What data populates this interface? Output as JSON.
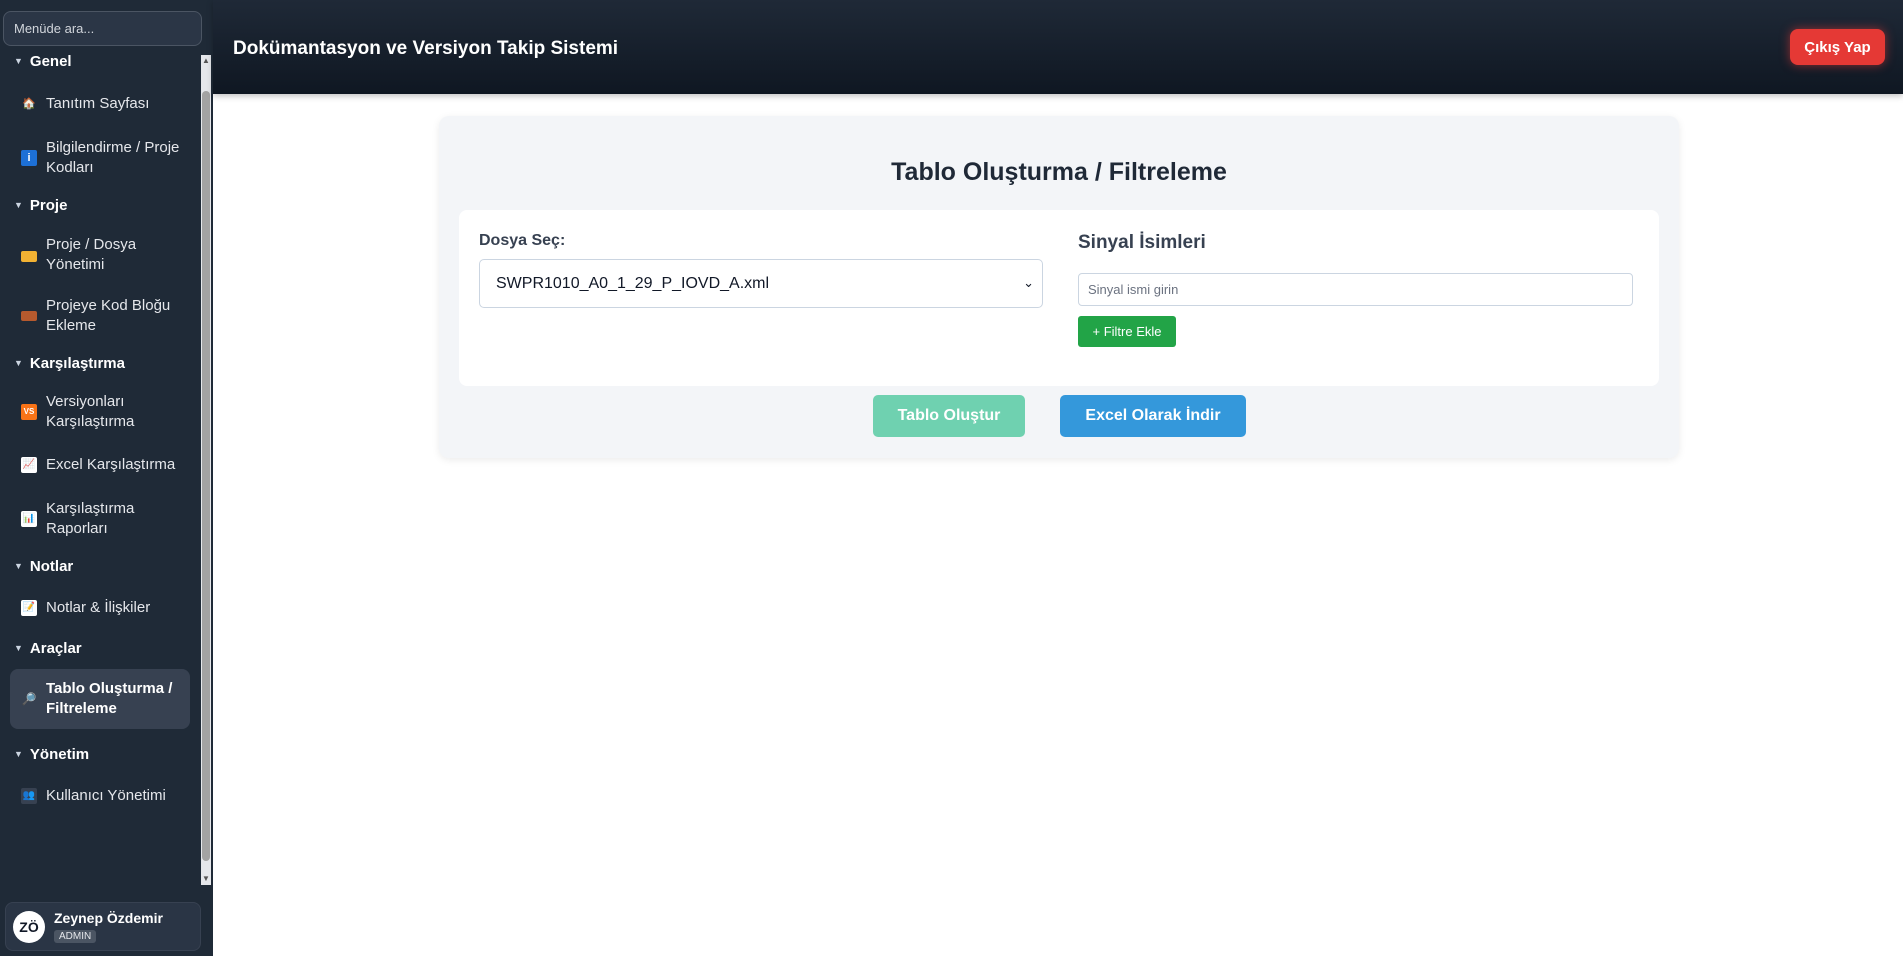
{
  "sidebar": {
    "search_placeholder": "Menüde ara...",
    "sections": [
      {
        "title": "Genel",
        "items": [
          {
            "label": "Tanıtım Sayfası",
            "icon": "home-icon"
          },
          {
            "label": "Bilgilendirme / Proje Kodları",
            "icon": "info-icon"
          }
        ]
      },
      {
        "title": "Proje",
        "items": [
          {
            "label": "Proje / Dosya Yönetimi",
            "icon": "folder-icon"
          },
          {
            "label": "Projeye Kod Bloğu Ekleme",
            "icon": "bricks-icon"
          }
        ]
      },
      {
        "title": "Karşılaştırma",
        "items": [
          {
            "label": "Versiyonları Karşılaştırma",
            "icon": "vs-icon"
          },
          {
            "label": "Excel Karşılaştırma",
            "icon": "chart-up-icon"
          },
          {
            "label": "Karşılaştırma Raporları",
            "icon": "bar-chart-icon"
          }
        ]
      },
      {
        "title": "Notlar",
        "items": [
          {
            "label": "Notlar & İlişkiler",
            "icon": "memo-icon"
          }
        ]
      },
      {
        "title": "Araçlar",
        "items": [
          {
            "label": "Tablo Oluşturma / Filtreleme",
            "icon": "magnifier-icon",
            "active": true
          }
        ]
      },
      {
        "title": "Yönetim",
        "items": [
          {
            "label": "Kullanıcı Yönetimi",
            "icon": "user-admin-icon"
          }
        ]
      }
    ],
    "user": {
      "initials": "ZÖ",
      "name": "Zeynep Özdemir",
      "role": "ADMIN"
    }
  },
  "header": {
    "title": "Dokümantasyon ve Versiyon Takip Sistemi",
    "logout_label": "Çıkış Yap"
  },
  "main": {
    "title": "Tablo Oluşturma / Filtreleme",
    "file_label": "Dosya Seç:",
    "file_selected": "SWPR1010_A0_1_29_P_IOVD_A.xml",
    "signal_title": "Sinyal İsimleri",
    "signal_placeholder": "Sinyal ismi girin",
    "add_filter_label": "+ Filtre Ekle",
    "create_table_label": "Tablo Oluştur",
    "excel_label": "Excel Olarak İndir"
  },
  "colors": {
    "sidebar_bg": "#1f2a37",
    "header_bg": "#111827",
    "logout": "#e53935",
    "add_filter": "#22a447",
    "create_table": "#6fd1b0",
    "excel": "#3498db"
  }
}
